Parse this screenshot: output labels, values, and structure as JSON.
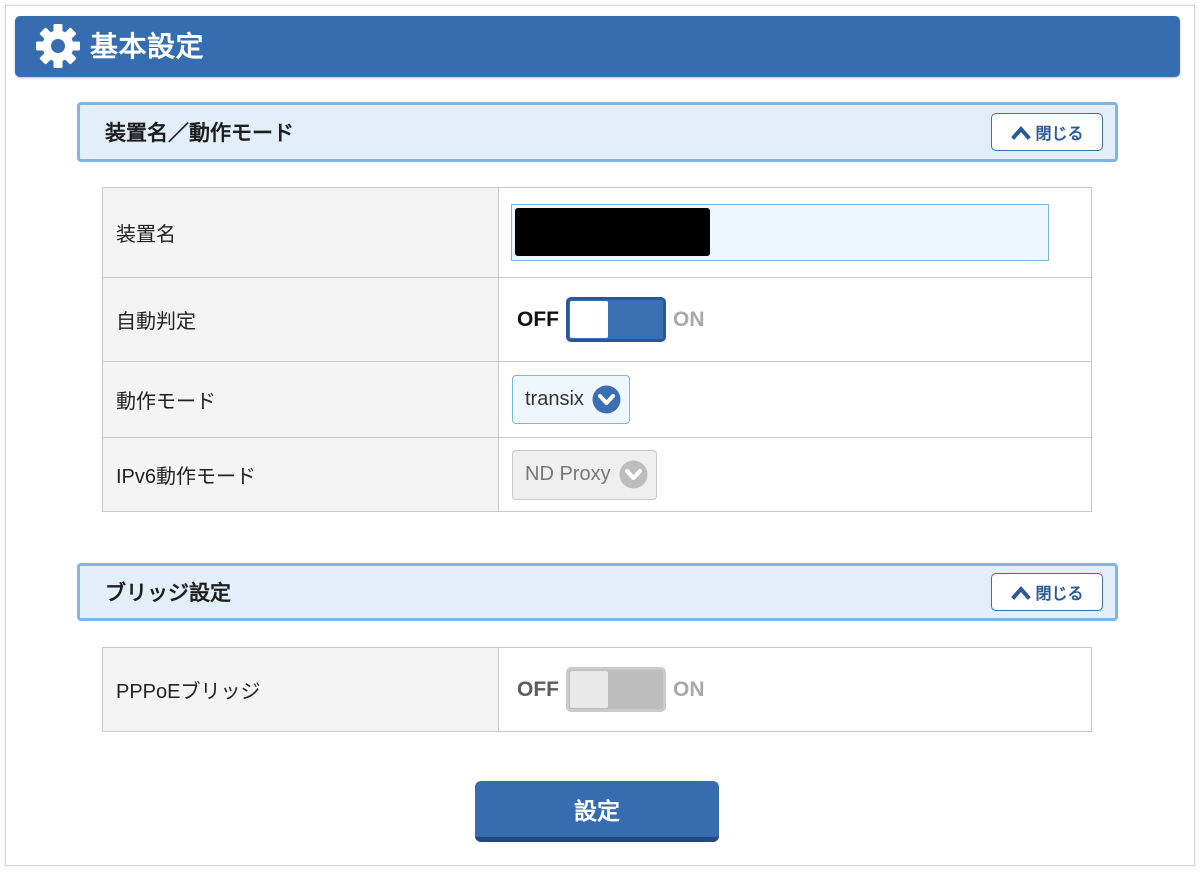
{
  "colors": {
    "accent": "#356db0",
    "accent_dark": "#22497f",
    "section_bg": "#e3eefb",
    "section_border": "#80b5e8"
  },
  "header": {
    "title": "基本設定",
    "icon": "gear-icon"
  },
  "sections": [
    {
      "title": "装置名／動作モード",
      "close_button": {
        "label": "閉じる",
        "icon": "chevron-up-icon"
      },
      "rows": [
        {
          "label": "装置名",
          "redacted": true
        },
        {
          "label": "自動判定",
          "off_label": "OFF",
          "on_label": "ON",
          "checked": false,
          "disabled": false
        },
        {
          "label": "動作モード",
          "value": "transix",
          "icon": "chevron-down-circle-icon",
          "disabled": false
        },
        {
          "label": "IPv6動作モード",
          "value": "ND Proxy",
          "icon": "chevron-down-circle-icon",
          "disabled": true
        }
      ]
    },
    {
      "title": "ブリッジ設定",
      "close_button": {
        "label": "閉じる",
        "icon": "chevron-up-icon"
      },
      "rows": [
        {
          "label": "PPPoEブリッジ",
          "off_label": "OFF",
          "on_label": "ON",
          "checked": false,
          "disabled": true
        }
      ]
    }
  ],
  "submit_button": {
    "label": "設定"
  }
}
